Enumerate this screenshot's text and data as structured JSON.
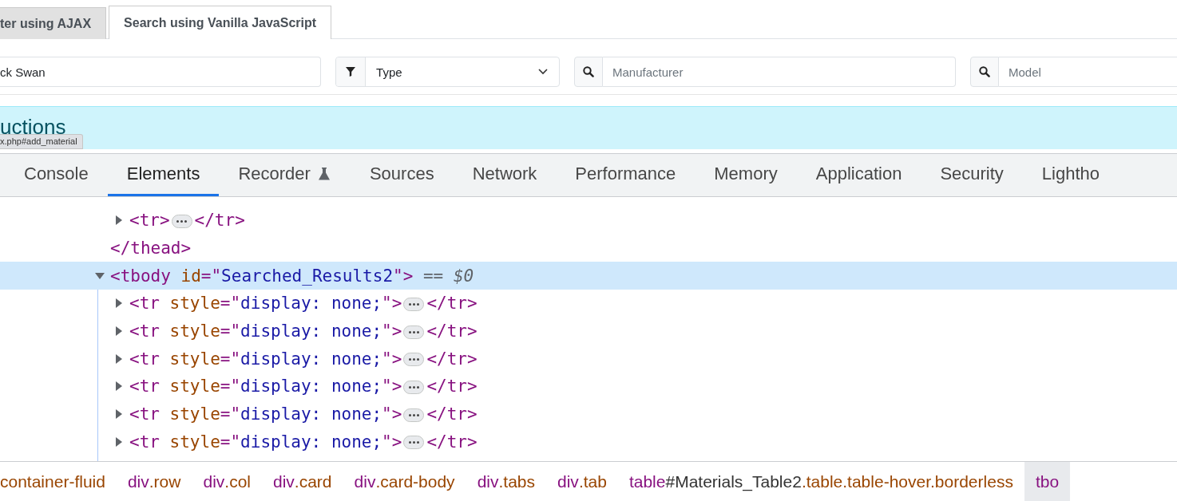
{
  "page": {
    "tabs": [
      {
        "label": "ter using AJAX",
        "selected": false
      },
      {
        "label": "Search using Vanilla JavaScript",
        "selected": true
      }
    ],
    "filters": [
      {
        "kind": "text",
        "value": "ck Swan"
      },
      {
        "kind": "select",
        "value": "Type"
      },
      {
        "kind": "search",
        "placeholder": "Manufacturer"
      },
      {
        "kind": "search",
        "placeholder": "Model"
      }
    ],
    "alert": {
      "heading": "uctions"
    },
    "link_tooltip": "x.php#add_material"
  },
  "devtools": {
    "tabs": [
      {
        "label": "Console",
        "selected": false
      },
      {
        "label": "Elements",
        "selected": true
      },
      {
        "label": "Recorder",
        "selected": false,
        "kind": "experimental"
      },
      {
        "label": "Sources",
        "selected": false
      },
      {
        "label": "Network",
        "selected": false
      },
      {
        "label": "Performance",
        "selected": false
      },
      {
        "label": "Memory",
        "selected": false
      },
      {
        "label": "Application",
        "selected": false
      },
      {
        "label": "Security",
        "selected": false
      },
      {
        "label": "Lightho",
        "selected": false
      }
    ],
    "tree": [
      {
        "expanded": true,
        "selected": false,
        "children": [
          {
            "expanded": false,
            "selected": false,
            "parts": [
              {
                "kind": "tag",
                "text": "<tr>"
              },
              {
                "kind": "collapsed"
              },
              {
                "kind": "tag",
                "text": "</tr>"
              }
            ]
          }
        ],
        "closing_parts": [
          {
            "kind": "tag",
            "text": "</thead>"
          }
        ]
      },
      {
        "expanded": true,
        "selected": true,
        "parts": [
          {
            "kind": "tag",
            "text": "<tbody"
          },
          {
            "kind": "attr",
            "text": " id"
          },
          {
            "kind": "tag",
            "text": "=\""
          },
          {
            "kind": "value",
            "text": "Searched_Results2"
          },
          {
            "kind": "tag",
            "text": "\">"
          },
          {
            "kind": "note",
            "text": " == $0"
          }
        ],
        "children": [
          {
            "expanded": false,
            "selected": false,
            "parts": [
              {
                "kind": "tag",
                "text": "<tr"
              },
              {
                "kind": "attr",
                "text": " style"
              },
              {
                "kind": "tag",
                "text": "=\""
              },
              {
                "kind": "value",
                "text": "display: none;"
              },
              {
                "kind": "tag",
                "text": "\">"
              },
              {
                "kind": "collapsed"
              },
              {
                "kind": "tag",
                "text": "</tr>"
              }
            ]
          },
          {
            "expanded": false,
            "selected": false,
            "parts": [
              {
                "kind": "tag",
                "text": "<tr"
              },
              {
                "kind": "attr",
                "text": " style"
              },
              {
                "kind": "tag",
                "text": "=\""
              },
              {
                "kind": "value",
                "text": "display: none;"
              },
              {
                "kind": "tag",
                "text": "\">"
              },
              {
                "kind": "collapsed"
              },
              {
                "kind": "tag",
                "text": "</tr>"
              }
            ]
          },
          {
            "expanded": false,
            "selected": false,
            "parts": [
              {
                "kind": "tag",
                "text": "<tr"
              },
              {
                "kind": "attr",
                "text": " style"
              },
              {
                "kind": "tag",
                "text": "=\""
              },
              {
                "kind": "value",
                "text": "display: none;"
              },
              {
                "kind": "tag",
                "text": "\">"
              },
              {
                "kind": "collapsed"
              },
              {
                "kind": "tag",
                "text": "</tr>"
              }
            ]
          },
          {
            "expanded": false,
            "selected": false,
            "parts": [
              {
                "kind": "tag",
                "text": "<tr"
              },
              {
                "kind": "attr",
                "text": " style"
              },
              {
                "kind": "tag",
                "text": "=\""
              },
              {
                "kind": "value",
                "text": "display: none;"
              },
              {
                "kind": "tag",
                "text": "\">"
              },
              {
                "kind": "collapsed"
              },
              {
                "kind": "tag",
                "text": "</tr>"
              }
            ]
          },
          {
            "expanded": false,
            "selected": false,
            "parts": [
              {
                "kind": "tag",
                "text": "<tr"
              },
              {
                "kind": "attr",
                "text": " style"
              },
              {
                "kind": "tag",
                "text": "=\""
              },
              {
                "kind": "value",
                "text": "display: none;"
              },
              {
                "kind": "tag",
                "text": "\">"
              },
              {
                "kind": "collapsed"
              },
              {
                "kind": "tag",
                "text": "</tr>"
              }
            ]
          },
          {
            "expanded": false,
            "selected": false,
            "parts": [
              {
                "kind": "tag",
                "text": "<tr"
              },
              {
                "kind": "attr",
                "text": " style"
              },
              {
                "kind": "tag",
                "text": "=\""
              },
              {
                "kind": "value",
                "text": "display: none;"
              },
              {
                "kind": "tag",
                "text": "\">"
              },
              {
                "kind": "collapsed"
              },
              {
                "kind": "tag",
                "text": "</tr>"
              }
            ]
          }
        ]
      }
    ],
    "breadcrumbs": [
      {
        "classes": "container-fluid",
        "selected": false
      },
      {
        "tag": "div",
        "classes": ".row",
        "selected": false
      },
      {
        "tag": "div",
        "classes": ".col",
        "selected": false
      },
      {
        "tag": "div",
        "classes": ".card",
        "selected": false
      },
      {
        "tag": "div",
        "classes": ".card-body",
        "selected": false
      },
      {
        "tag": "div",
        "classes": ".tabs",
        "selected": false
      },
      {
        "tag": "div",
        "classes": ".tab",
        "selected": false
      },
      {
        "tag": "table",
        "id": "#Materials_Table2",
        "classes": ".table.table-hover.borderless",
        "selected": false
      },
      {
        "tag": "tbo",
        "selected": true
      }
    ]
  }
}
